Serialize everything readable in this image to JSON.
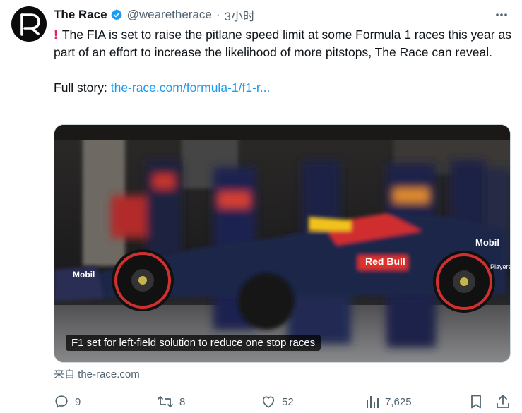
{
  "author": {
    "name": "The Race",
    "handle": "@wearetherace",
    "separator": "·",
    "time": "3小时",
    "avatar_letter": "R"
  },
  "tweet": {
    "text": "The FIA is set to raise the pitlane speed limit at some Formula 1 races this year as part of an effort to increase the likelihood of more pitstops, The Race can reveal.",
    "link_prefix": "Full story: ",
    "link_text": "the-race.com/formula-1/f1-r..."
  },
  "card": {
    "caption": "F1 set for left-field solution to reduce one stop races",
    "source": "来自 the-race.com",
    "image_text": {
      "sponsor_1": "Mobil",
      "sponsor_2": "Red Bull",
      "sponsor_3": "Mobil",
      "sponsor_4": "Players"
    }
  },
  "actions": {
    "replies": "9",
    "reposts": "8",
    "likes": "52",
    "views": "7,625"
  },
  "colors": {
    "link": "#1d9bf0",
    "verified": "#1d9bf0",
    "muted": "#536471",
    "alert": "#e0245e"
  },
  "icons": [
    "more-icon",
    "verified-badge-icon",
    "reply-icon",
    "repost-icon",
    "like-icon",
    "views-icon",
    "bookmark-icon",
    "share-icon"
  ]
}
